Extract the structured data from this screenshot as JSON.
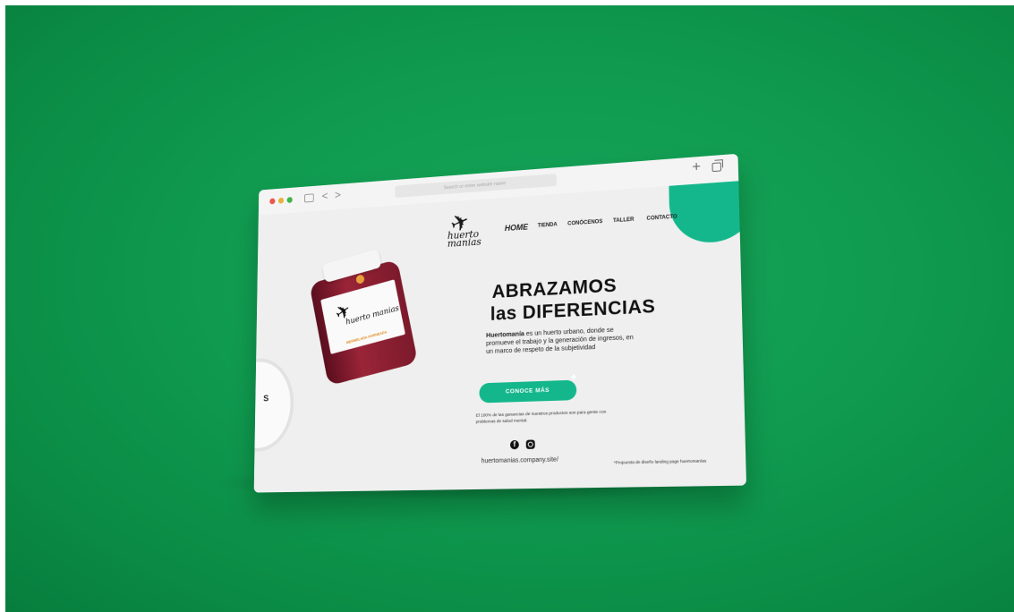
{
  "browser": {
    "address_placeholder": "Search or enter website name",
    "nav_back": "<",
    "nav_forward": ">",
    "new_tab": "+",
    "icons": [
      "sidebar-icon",
      "new-tab-icon",
      "tabs-overview-icon"
    ]
  },
  "site": {
    "logo_text": "huerto manias",
    "nav": {
      "home": "HOME",
      "tienda": "TIENDA",
      "conocenos": "CONÓCENOS",
      "taller": "TALLER",
      "contacto": "CONTACTO"
    },
    "jar": {
      "brand": "huerto manias",
      "flavor": "MERMELADA HORNEADA"
    },
    "plate_text": "S",
    "headline_line1": "ABRAZAMOS",
    "headline_line2": "las DIFERENCIAS",
    "body_bold": "Huertomanía",
    "body_rest": " es un huerto urbano, donde se promueve el trabajo y la generación de ingresos, en un marco de respeto de la subjetividad",
    "cta_label": "CONOCE MÁS",
    "note": "El 100% de las ganancias de nuestros productos son para gente con problemas de salud mental.",
    "url": "huertomanias.company.site/",
    "footnote": "*Propuesta de diseño landing page huertomanías"
  },
  "colors": {
    "background_green": "#0f9a4f",
    "accent_teal": "#14b78c",
    "jar_red": "#8a1e30"
  }
}
